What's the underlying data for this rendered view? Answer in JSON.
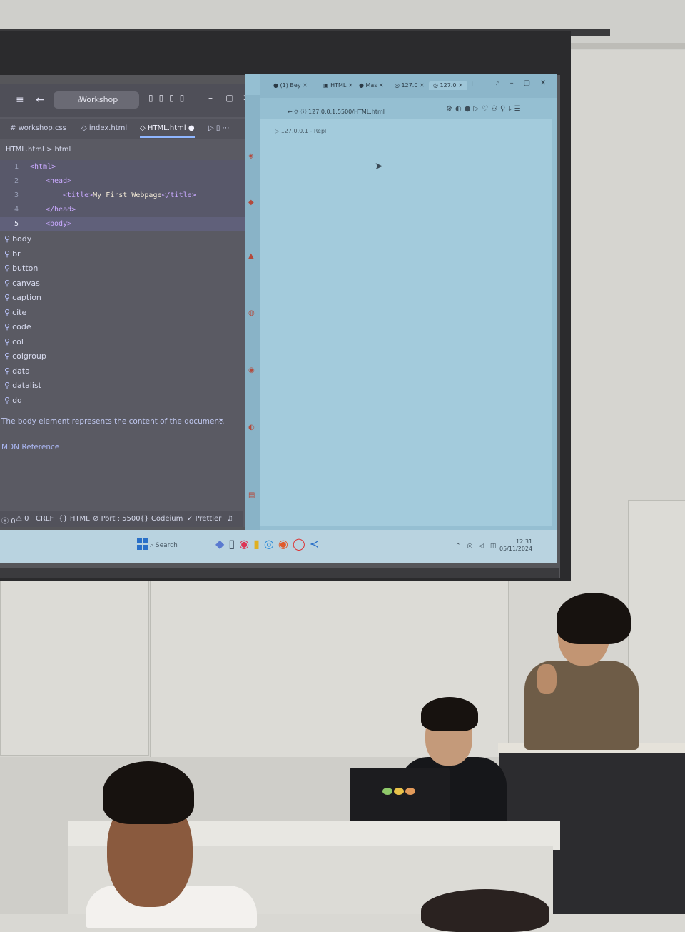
{
  "editor": {
    "search_placeholder": "Workshop",
    "tabs": [
      "workshop.css",
      "index.html",
      "HTML.html"
    ],
    "active_tab": "HTML.html",
    "breadcrumb": "HTML.html > html",
    "code_lines": [
      {
        "num": "1",
        "tag": "<html>",
        "text": ""
      },
      {
        "num": "2",
        "tag": "<head>",
        "text": ""
      },
      {
        "num": "3",
        "tag": "<title>",
        "text": "My First Webpage",
        "close": "</title>"
      },
      {
        "num": "4",
        "tag": "</head>",
        "text": ""
      },
      {
        "num": "5",
        "tag": "<body>",
        "text": ""
      }
    ],
    "suggestions": [
      "body",
      "br",
      "button",
      "canvas",
      "caption",
      "cite",
      "code",
      "col",
      "colgroup",
      "data",
      "datalist",
      "dd"
    ],
    "doc_text": "The body element represents the content of the document.",
    "doc_link": "MDN Reference",
    "status": {
      "errors": "0",
      "warnings": "0",
      "eol": "CRLF",
      "language": "HTML",
      "port": "Port : 5500",
      "codeium": "Codeium",
      "prettier": "Prettier"
    }
  },
  "browser": {
    "tabs": [
      "(1) Bey",
      "HTML",
      "Mas",
      "127.0",
      "127.0"
    ],
    "address": "127.0.0.1:5500/HTML.html",
    "page_title": "127.0.0.1 - Repl"
  },
  "taskbar": {
    "search_label": "Search",
    "time": "12:31",
    "date": "05/11/2024"
  },
  "colors": {
    "editor_bg": "#5a5a63",
    "browser_bg": "#a3cbdc",
    "accent": "#2a70c8"
  }
}
